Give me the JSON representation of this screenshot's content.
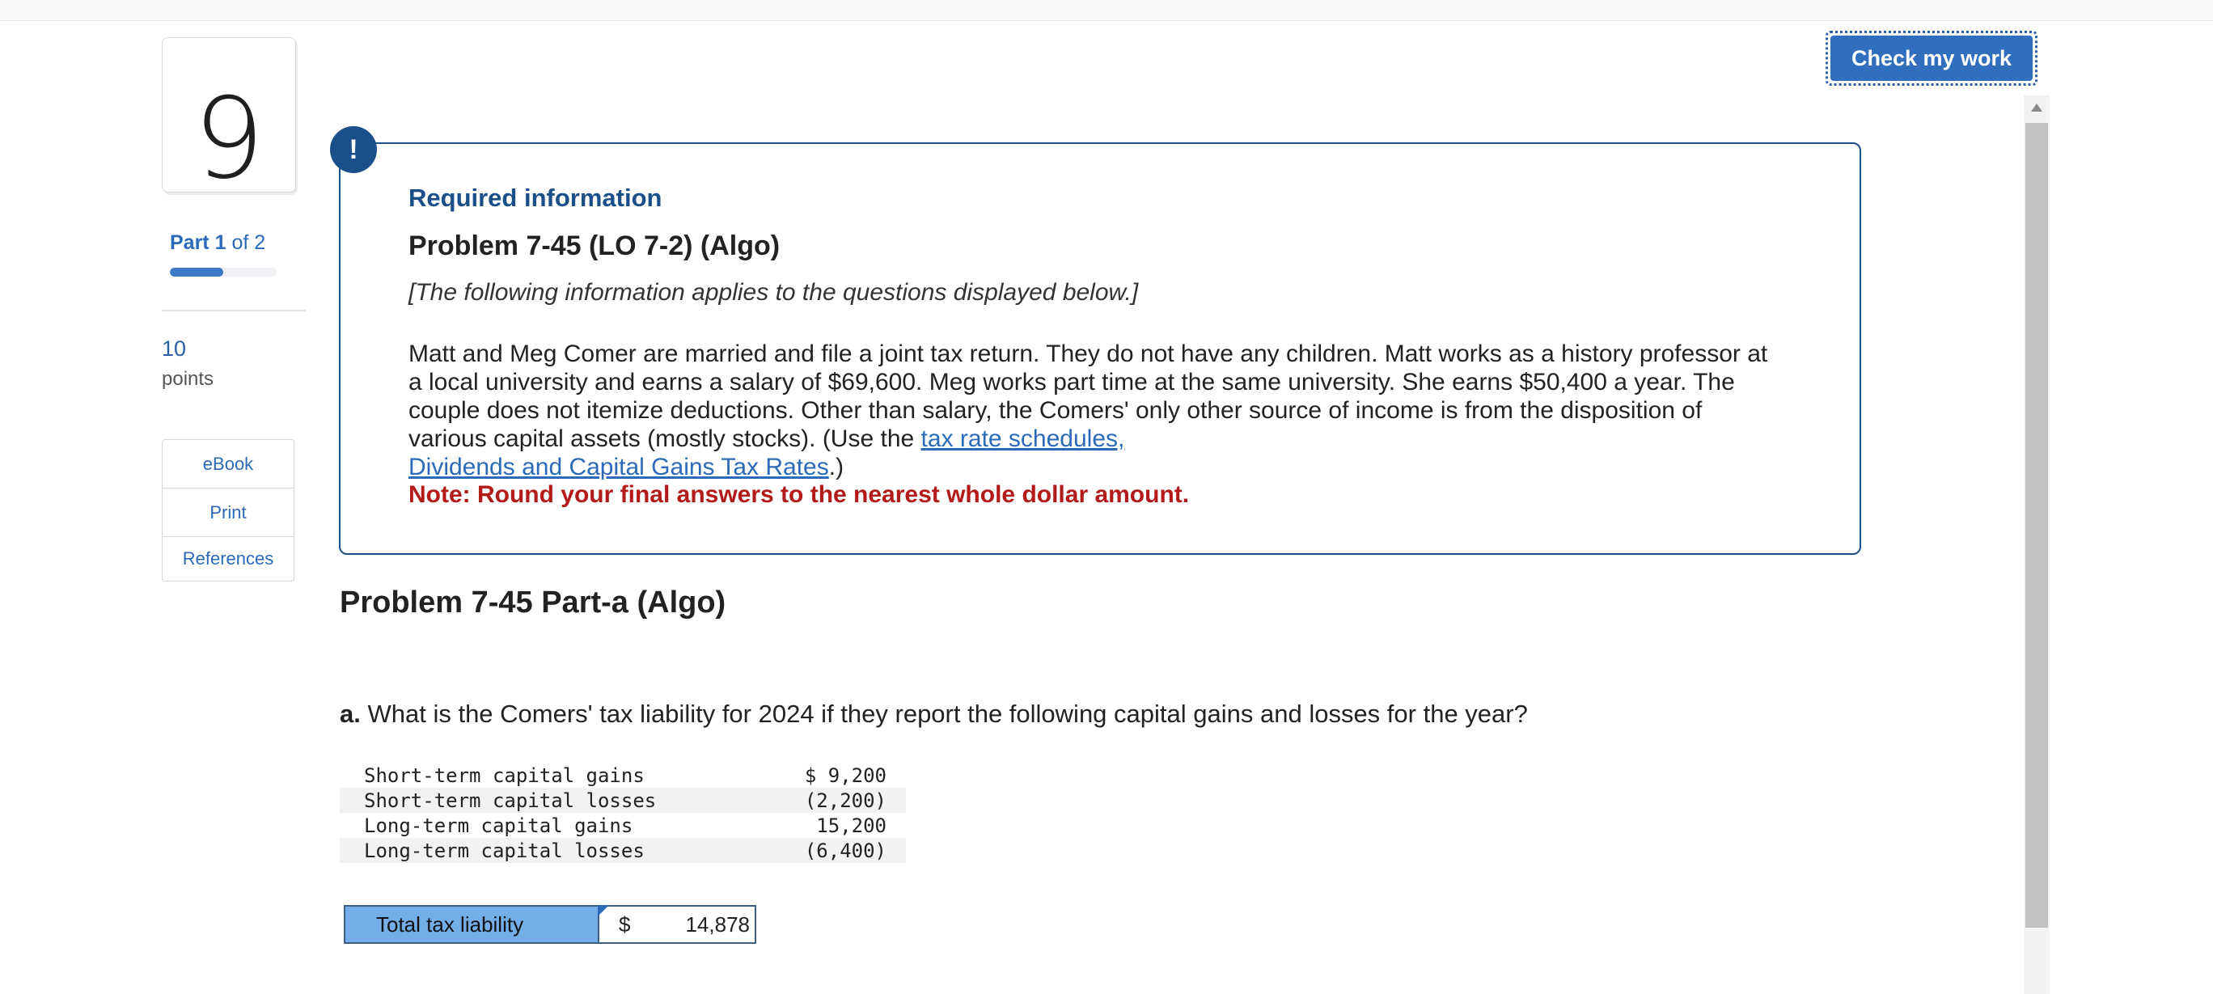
{
  "question": {
    "number": "9"
  },
  "part": {
    "current": "1",
    "of_text": "of 2",
    "progress_fraction": 0.5
  },
  "points": {
    "value": "10",
    "label": "points"
  },
  "side_buttons": [
    {
      "label": "eBook"
    },
    {
      "label": "Print"
    },
    {
      "label": "References"
    }
  ],
  "check_button": {
    "label": "Check my work"
  },
  "info": {
    "alert_icon": "!",
    "heading": "Required information",
    "problem_title": "Problem 7-45 (LO 7-2) (Algo)",
    "applies_text": "[The following information applies to the questions displayed below.]",
    "paragraph": "Matt and Meg Comer are married and file a joint tax return. They do not have any children. Matt works as a history professor at a local university and earns a salary of $69,600. Meg works part time at the same university. She earns $50,400 a year. The couple does not itemize deductions. Other than salary, the Comers' only other source of income is from the disposition of various capital assets (mostly stocks). (Use the",
    "link1": "tax rate schedules,",
    "link2": "Dividends and Capital Gains Tax Rates",
    "paragraph_end": ".)",
    "note": "Note: Round your final answers to the nearest whole dollar amount."
  },
  "part_a": {
    "title": "Problem 7-45 Part-a (Algo)",
    "question_prefix": "a.",
    "question_text": "What is the Comers' tax liability for 2024 if they report the following capital gains and losses for the year?",
    "rows": [
      {
        "label": "Short-term capital gains",
        "value": "$ 9,200"
      },
      {
        "label": "Short-term capital losses",
        "value": "(2,200)"
      },
      {
        "label": "Long-term capital gains",
        "value": "15,200"
      },
      {
        "label": "Long-term capital losses",
        "value": "(6,400)"
      }
    ],
    "answer_label": "Total tax liability",
    "answer_currency": "$",
    "answer_value": "14,878"
  }
}
